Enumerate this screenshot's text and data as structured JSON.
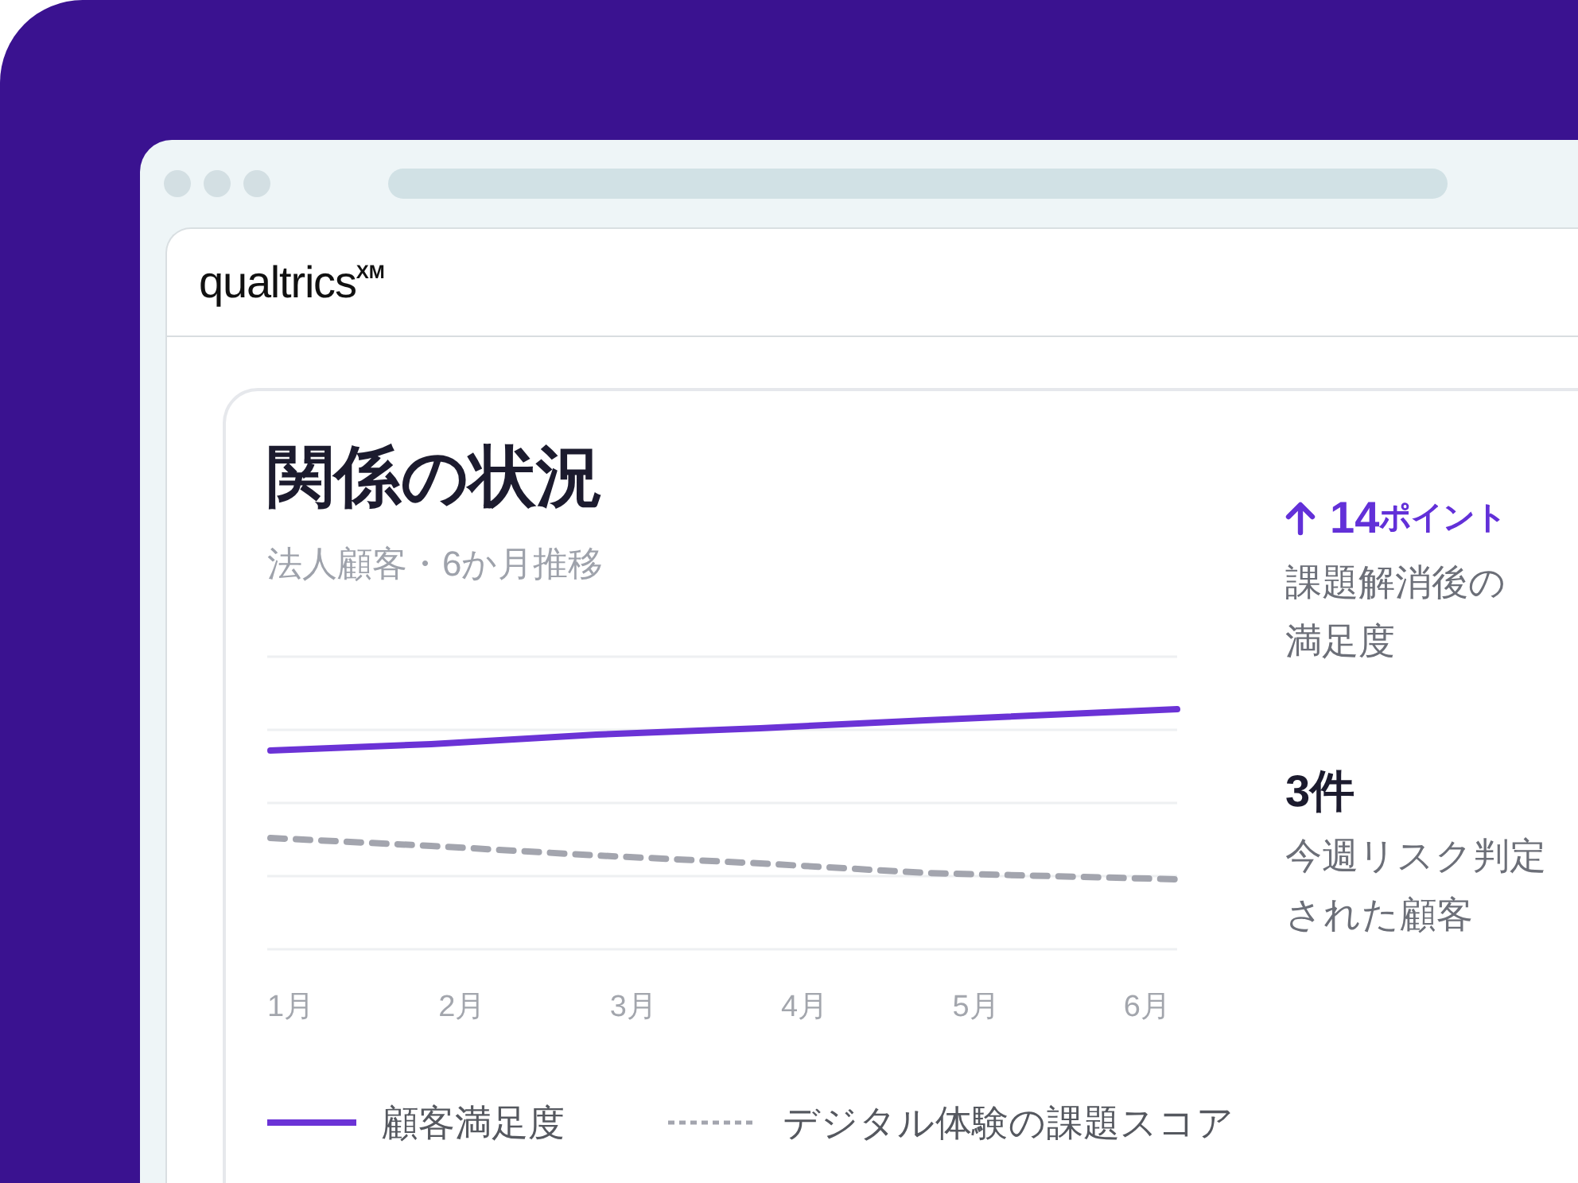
{
  "browser": {
    "logo": "qualtrics$^{XM}$"
  },
  "card": {
    "title": "関係の状況",
    "subtitle": "法人顧客・6か月推移",
    "chart": {
      "x_labels": [
        "1月",
        "2月",
        "3月",
        "4月",
        "5月",
        "6月"
      ],
      "series": [
        {
          "name": "顧客満足度",
          "kind": "solid",
          "color": "#6b33d6"
        },
        {
          "name": "デジタル体験の課題スコア",
          "kind": "dashed",
          "color": "#a3a5ae"
        }
      ]
    },
    "stats": [
      {
        "kind": "trend_up",
        "value": "14",
        "unit": "ポイント",
        "caption": "課題解消後の満足度"
      },
      {
        "kind": "count",
        "value": "3件",
        "caption": "今週リスク判定された顧客"
      }
    ]
  }
}
